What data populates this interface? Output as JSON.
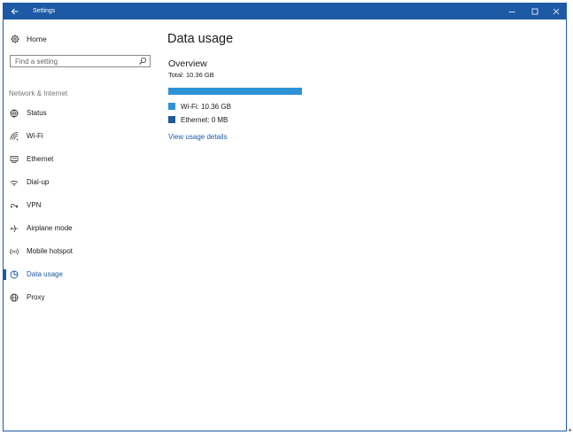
{
  "window": {
    "title": "Settings"
  },
  "sidebar": {
    "home_label": "Home",
    "search_placeholder": "Find a setting",
    "section_label": "Network & Internet",
    "items": [
      {
        "label": "Status",
        "icon": "status-icon"
      },
      {
        "label": "Wi-Fi",
        "icon": "wifi-icon"
      },
      {
        "label": "Ethernet",
        "icon": "ethernet-icon"
      },
      {
        "label": "Dial-up",
        "icon": "dialup-icon"
      },
      {
        "label": "VPN",
        "icon": "vpn-icon"
      },
      {
        "label": "Airplane mode",
        "icon": "airplane-icon"
      },
      {
        "label": "Mobile hotspot",
        "icon": "hotspot-icon"
      },
      {
        "label": "Data usage",
        "icon": "data-usage-icon",
        "active": true
      },
      {
        "label": "Proxy",
        "icon": "globe-icon"
      }
    ]
  },
  "main": {
    "title": "Data usage",
    "overview_heading": "Overview",
    "total": "Total: 10.36 GB",
    "usage_fill_fraction": 1.0,
    "legend": [
      {
        "label": "Wi-Fi: 10.36 GB",
        "color": "#2e92d7"
      },
      {
        "label": "Ethernet: 0 MB",
        "color": "#1c5a9c"
      }
    ],
    "details_link": "View usage details"
  },
  "colors": {
    "accent": "#1c5aa6",
    "bar": "#2e92d7"
  }
}
